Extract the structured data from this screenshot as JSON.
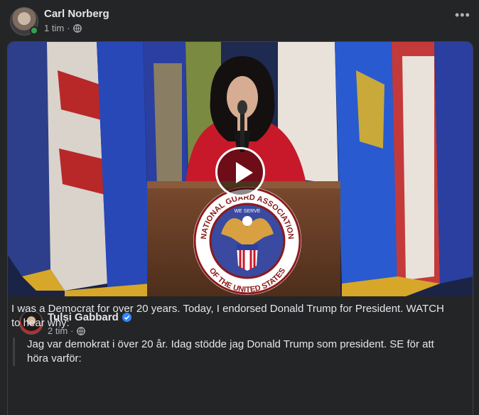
{
  "post": {
    "author": "Carl Norberg",
    "time": "1 tim",
    "separator": "·",
    "audience_icon": "globe-icon",
    "more_icon": "more-horizontal-icon",
    "more_label": "•••"
  },
  "shared_post": {
    "video": {
      "play_icon": "play-icon",
      "logo_text_top": "NATIONAL GUARD ASSOCIATION",
      "logo_text_bottom": "OF THE UNITED STATES",
      "logo_motto": "WE SERVE"
    },
    "author": "Tulsi Gabbard",
    "verified_icon": "verified-badge-icon",
    "time": "2 tim",
    "separator": "·",
    "audience_icon": "globe-icon",
    "text": "I was a Democrat for over 20 years. Today, I endorsed Donald Trump for President.   WATCH to hear why:",
    "translation": "Jag var demokrat i över 20 år. Idag stödde jag Donald Trump som president. SE för att höra varför:"
  },
  "colors": {
    "background": "#242526",
    "text_primary": "#e4e6eb",
    "text_secondary": "#b0b3b8",
    "online": "#31a24c",
    "verified": "#2d88ff"
  }
}
